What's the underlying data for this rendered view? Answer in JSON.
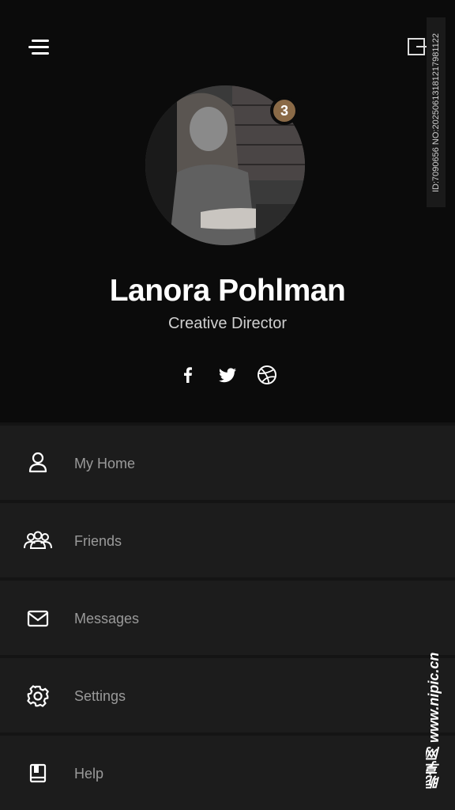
{
  "profile": {
    "name": "Lanora Pohlman",
    "role": "Creative Director",
    "badge_count": "3"
  },
  "icons": {
    "menu": "hamburger-menu-icon",
    "logout": "logout-icon",
    "facebook": "facebook-icon",
    "twitter": "twitter-icon",
    "dribbble": "dribbble-icon"
  },
  "menu": {
    "items": [
      {
        "label": "My Home",
        "icon": "user-icon"
      },
      {
        "label": "Friends",
        "icon": "group-icon"
      },
      {
        "label": "Messages",
        "icon": "mail-icon"
      },
      {
        "label": "Settings",
        "icon": "gear-icon"
      },
      {
        "label": "Help",
        "icon": "book-icon"
      }
    ]
  },
  "colors": {
    "background": "#0b0b0b",
    "menu_item": "#1c1c1c",
    "badge": "#8a6a47",
    "menu_text": "#9a9a9a"
  },
  "watermark": {
    "id_text": "ID:7090656 NO:20250613181217981122",
    "site_text": "昵享网 www.nipic.cn"
  }
}
